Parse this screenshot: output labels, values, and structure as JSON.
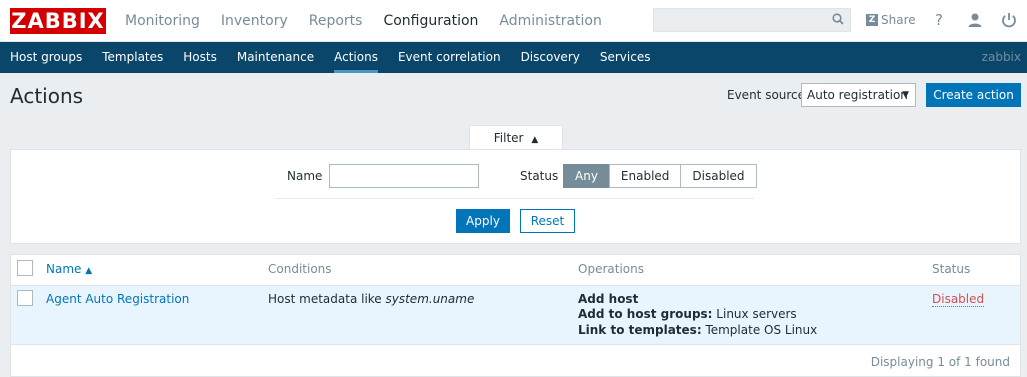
{
  "brand": {
    "logo_text": "ZABBIX",
    "logo_color": "#d40000"
  },
  "main_menu": [
    {
      "label": "Monitoring",
      "active": false
    },
    {
      "label": "Inventory",
      "active": false
    },
    {
      "label": "Reports",
      "active": false
    },
    {
      "label": "Configuration",
      "active": true
    },
    {
      "label": "Administration",
      "active": false
    }
  ],
  "topbar": {
    "search_value": "",
    "share_label": "Share",
    "help_label": "?"
  },
  "sub_menu": [
    {
      "label": "Host groups",
      "active": false
    },
    {
      "label": "Templates",
      "active": false
    },
    {
      "label": "Hosts",
      "active": false
    },
    {
      "label": "Maintenance",
      "active": false
    },
    {
      "label": "Actions",
      "active": true
    },
    {
      "label": "Event correlation",
      "active": false
    },
    {
      "label": "Discovery",
      "active": false
    },
    {
      "label": "Services",
      "active": false
    }
  ],
  "server_name": "zabbix",
  "page": {
    "title": "Actions",
    "event_source_label": "Event source",
    "event_source_value": "Auto registration",
    "create_button": "Create action"
  },
  "filter": {
    "tab_label": "Filter",
    "name_label": "Name",
    "name_value": "",
    "status_label": "Status",
    "status_options": [
      "Any",
      "Enabled",
      "Disabled"
    ],
    "status_selected": "Any",
    "apply_label": "Apply",
    "reset_label": "Reset"
  },
  "table": {
    "columns": {
      "name": "Name",
      "conditions": "Conditions",
      "operations": "Operations",
      "status": "Status"
    },
    "rows": [
      {
        "name": "Agent Auto Registration",
        "condition_prefix": "Host metadata like ",
        "condition_value": "system.uname",
        "op_title": "Add host",
        "op_groups_label": "Add to host groups:",
        "op_groups_value": " Linux servers",
        "op_templates_label": "Link to templates:",
        "op_templates_value": " Template OS Linux",
        "status": "Disabled"
      }
    ],
    "footer": "Displaying 1 of 1 found"
  },
  "colors": {
    "nav_bg": "#0a466a",
    "accent": "#0275b8",
    "disabled": "#d64e4e",
    "row_highlight": "#e8f5ff"
  }
}
